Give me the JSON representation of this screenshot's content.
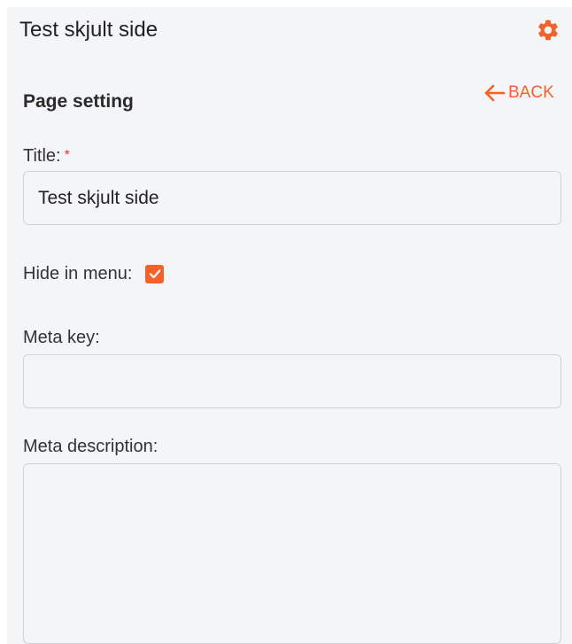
{
  "header": {
    "page_name": "Test skjult side",
    "settings_icon": "gear-icon"
  },
  "section": {
    "title": "Page setting",
    "back_label": "BACK",
    "back_icon": "arrow-left-icon"
  },
  "form": {
    "title_label": "Title:",
    "title_required_mark": "*",
    "title_value": "Test skjult side",
    "hide_in_menu_label": "Hide in menu:",
    "hide_in_menu_checked": true,
    "meta_key_label": "Meta key:",
    "meta_key_value": "",
    "meta_description_label": "Meta description:",
    "meta_description_value": ""
  },
  "colors": {
    "accent": "#f4622b",
    "required": "#e53935",
    "panel_background": "#f4f5f7",
    "input_border": "#cfd3d8"
  }
}
